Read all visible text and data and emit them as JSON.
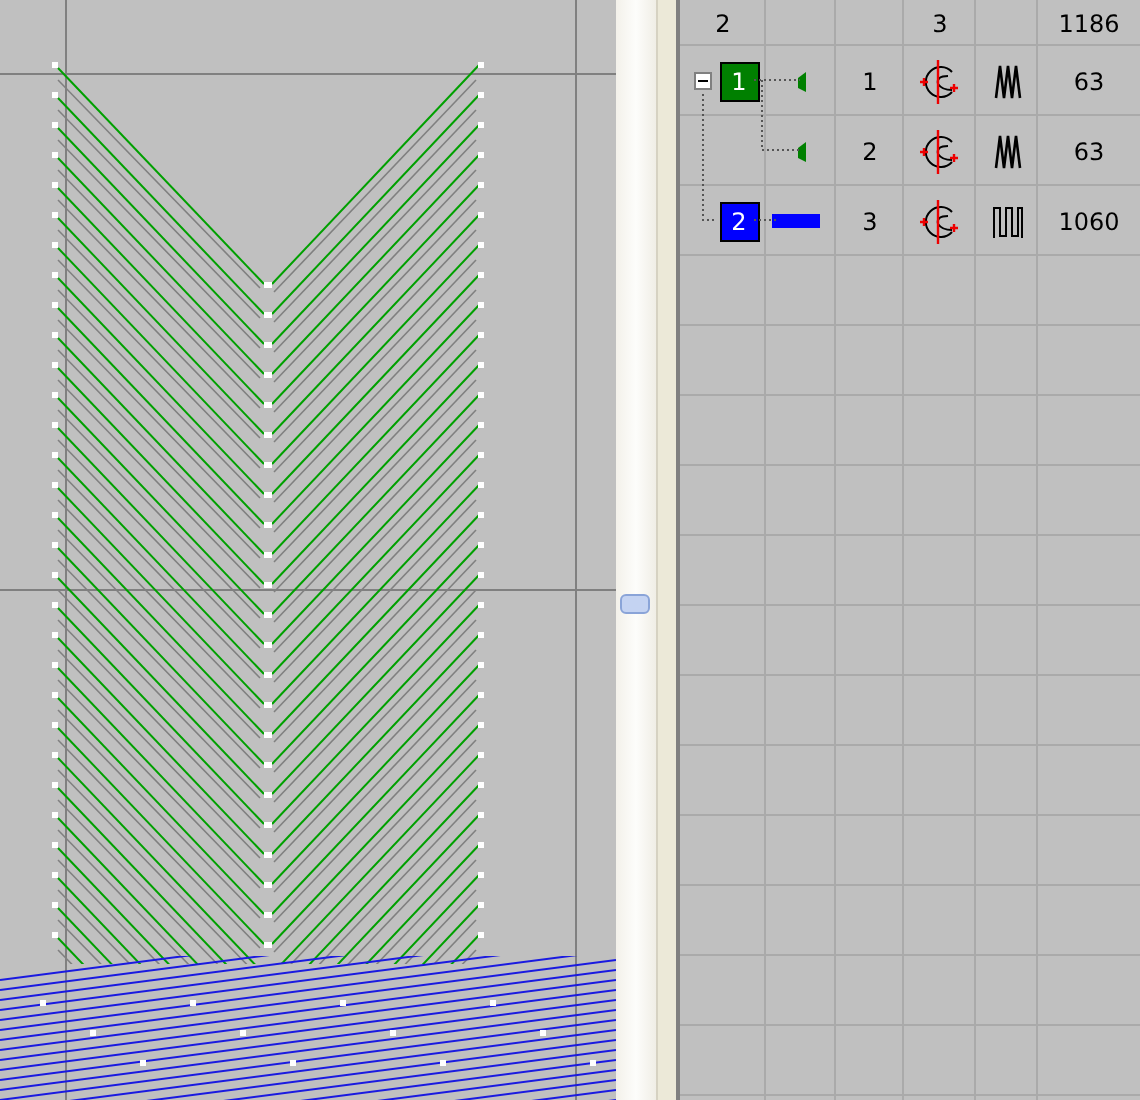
{
  "header": {
    "column_1": "2",
    "column_4": "3",
    "column_6": "1186"
  },
  "groups": [
    {
      "label": "1",
      "color": "#008000",
      "expanded": true,
      "children": [
        {
          "number": "1",
          "kind": "satin",
          "count": "63"
        },
        {
          "number": "2",
          "kind": "satin",
          "count": "63"
        }
      ]
    },
    {
      "label": "2",
      "color": "#0000ff",
      "children": [
        {
          "number": "3",
          "kind": "running",
          "count": "1060"
        }
      ]
    }
  ]
}
